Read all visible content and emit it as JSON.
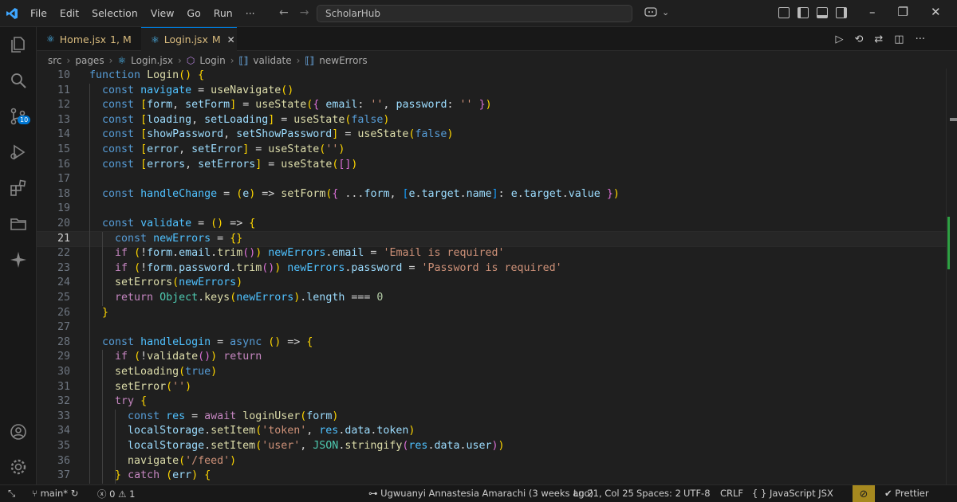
{
  "menu": [
    "File",
    "Edit",
    "Selection",
    "View",
    "Go",
    "Run",
    "···"
  ],
  "command_center": "ScholarHub",
  "tabs": [
    {
      "label": "Home.jsx",
      "status": "1, M"
    },
    {
      "label": "Login.jsx",
      "status": "M"
    }
  ],
  "breadcrumb": [
    "src",
    "pages",
    "Login.jsx",
    "Login",
    "validate",
    "newErrors"
  ],
  "activity_badge": "10",
  "code_lines": [
    {
      "n": "10",
      "code": "function Login() {"
    },
    {
      "n": "11",
      "code": "  const navigate = useNavigate()"
    },
    {
      "n": "12",
      "code": "  const [form, setForm] = useState({ email: '', password: '' })"
    },
    {
      "n": "13",
      "code": "  const [loading, setLoading] = useState(false)"
    },
    {
      "n": "14",
      "code": "  const [showPassword, setShowPassword] = useState(false)"
    },
    {
      "n": "15",
      "code": "  const [error, setError] = useState('')"
    },
    {
      "n": "16",
      "code": "  const [errors, setErrors] = useState([])"
    },
    {
      "n": "17",
      "code": ""
    },
    {
      "n": "18",
      "code": "  const handleChange = (e) => setForm({ ...form, [e.target.name]: e.target.value })"
    },
    {
      "n": "19",
      "code": ""
    },
    {
      "n": "20",
      "code": "  const validate = () => {"
    },
    {
      "n": "21",
      "code": "    const newErrors = {}"
    },
    {
      "n": "22",
      "code": "    if (!form.email.trim()) newErrors.email = 'Email is required'"
    },
    {
      "n": "23",
      "code": "    if (!form.password.trim()) newErrors.password = 'Password is required'"
    },
    {
      "n": "24",
      "code": "    setErrors(newErrors)"
    },
    {
      "n": "25",
      "code": "    return Object.keys(newErrors).length === 0"
    },
    {
      "n": "26",
      "code": "  }"
    },
    {
      "n": "27",
      "code": ""
    },
    {
      "n": "28",
      "code": "  const handleLogin = async () => {"
    },
    {
      "n": "29",
      "code": "    if (!validate()) return"
    },
    {
      "n": "30",
      "code": "    setLoading(true)"
    },
    {
      "n": "31",
      "code": "    setError('')"
    },
    {
      "n": "32",
      "code": "    try {"
    },
    {
      "n": "33",
      "code": "      const res = await loginUser(form)"
    },
    {
      "n": "34",
      "code": "      localStorage.setItem('token', res.data.token)"
    },
    {
      "n": "35",
      "code": "      localStorage.setItem('user', JSON.stringify(res.data.user))"
    },
    {
      "n": "36",
      "code": "      navigate('/feed')"
    },
    {
      "n": "37",
      "code": "    } catch (err) {"
    }
  ],
  "current_line": "21",
  "status": {
    "branch": "main*",
    "errors": "0",
    "warnings": "1",
    "blame": "Ugwuanyi Annastesia Amarachi (3 weeks ago)",
    "position": "Ln 21, Col 25",
    "spaces": "Spaces: 2",
    "encoding": "UTF-8",
    "eol": "CRLF",
    "language": "JavaScript JSX",
    "formatter": "Prettier"
  },
  "colors": {
    "accent": "#0078d4",
    "modified": "#d7ba7d",
    "git_added": "#2ea043"
  }
}
